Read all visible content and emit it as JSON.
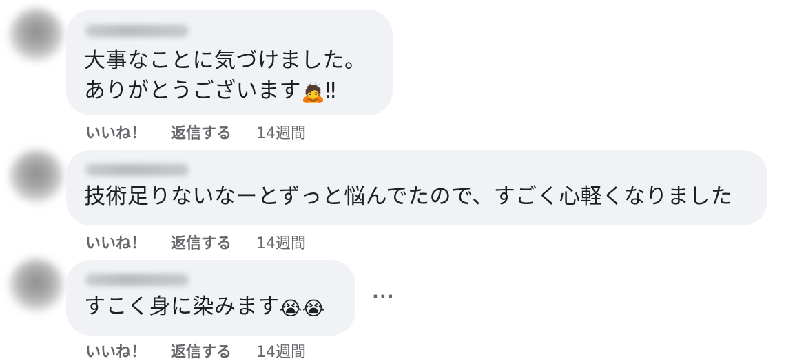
{
  "comments": [
    {
      "text_line1": "大事なことに気づけました。",
      "text_line2": "ありがとうございます",
      "emoji": "🙇",
      "suffix": "‼",
      "like_label": "いいね！",
      "reply_label": "返信する",
      "time": "14週間"
    },
    {
      "text_line1": "技術足りないなーとずっと悩んでたので、すごく心軽くなりました",
      "like_label": "いいね！",
      "reply_label": "返信する",
      "time": "14週間"
    },
    {
      "text_line1": "すこく身に染みます",
      "emoji": "😭😭",
      "like_label": "いいね！",
      "reply_label": "返信する",
      "time": "14週間"
    }
  ],
  "more_options": "···"
}
